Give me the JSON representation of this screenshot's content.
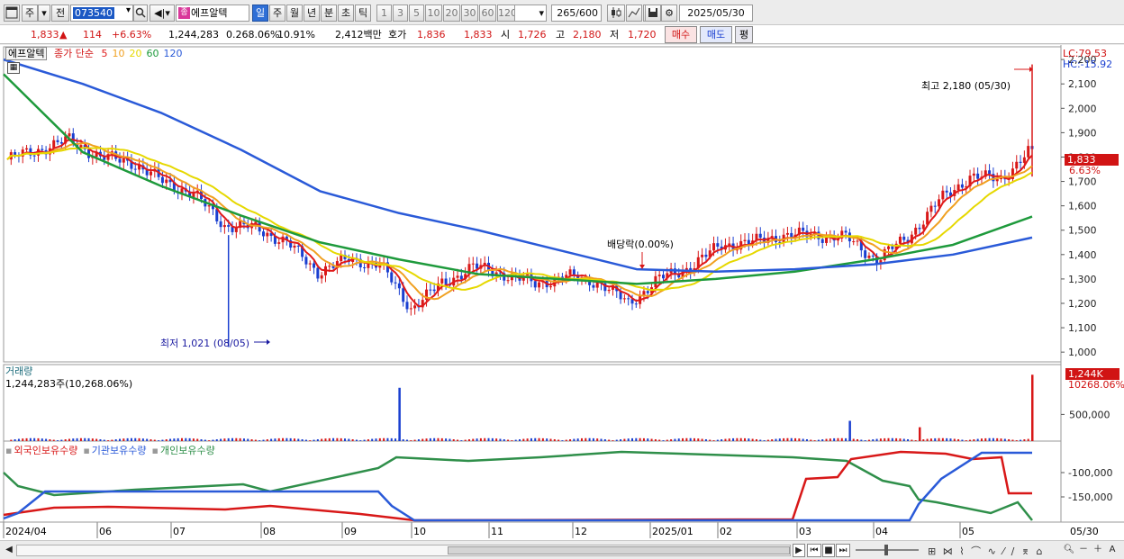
{
  "toolbar": {
    "market_label": "주",
    "prev_label": "전",
    "stock_code": "073540",
    "stock_name": "에프알텍",
    "name_badge": "종",
    "periods": [
      "일",
      "주",
      "월",
      "년",
      "분",
      "초",
      "틱"
    ],
    "selected_period": "일",
    "intervals": [
      "1",
      "3",
      "5",
      "10",
      "20",
      "30",
      "60",
      "120"
    ],
    "count_display": "265",
    "count_total": "/600",
    "date": "2025/05/30"
  },
  "quote": {
    "price": "1,833",
    "change": "114",
    "change_pct": "+6.63%",
    "volume": "1,244,283",
    "volume_pct": "0.268.06%",
    "turnover_pct": "10.91%",
    "amount": "2,412백만",
    "bid_label": "호가",
    "bid": "1,836",
    "ask": "1,833",
    "open_label": "시",
    "open": "1,726",
    "high_label": "고",
    "high": "2,180",
    "low_label": "저",
    "low": "1,720",
    "buy_button": "매수",
    "sell_button": "매도",
    "eval_button": "평"
  },
  "chart": {
    "legend_name": "에프알텍",
    "legend_ma_prefix": "종가 단순",
    "legend_ma": [
      {
        "label": "5",
        "color": "#e01a1a"
      },
      {
        "label": "10",
        "color": "#f0a020"
      },
      {
        "label": "20",
        "color": "#e6d800"
      },
      {
        "label": "60",
        "color": "#1e9a3c"
      },
      {
        "label": "120",
        "color": "#2a5ad8"
      }
    ],
    "lc_label": "LC:79.53",
    "hc_label": "HC:-15.92",
    "high_annotation": "최고 2,180 (05/30)",
    "low_annotation": "최저 1,021 (08/05)",
    "dividend_annotation": "배당락(0.00%)",
    "price_tag": "1,833",
    "price_pct_tag": "6.63%",
    "volume_title": "거래량",
    "volume_value": "1,244,283주(10,268.06%)",
    "volume_tag": "1,244K",
    "volume_pct_tag": "10268.06%",
    "holdings_legend": [
      "외국인보유수량",
      "기관보유수량",
      "개인보유수량"
    ],
    "x_labels": [
      "2024/04",
      "06",
      "07",
      "08",
      "09",
      "10",
      "11",
      "12",
      "2025/01",
      "02",
      "03",
      "04",
      "05"
    ],
    "x_right_label": "05/30"
  },
  "chart_data": [
    {
      "type": "candlestick",
      "title": "에프알텍",
      "y_ticks": [
        1000,
        1100,
        1200,
        1300,
        1400,
        1500,
        1600,
        1700,
        1800,
        1900,
        2000,
        2100,
        2200
      ],
      "y_tick_labels": [
        "1,000",
        "1,100",
        "1,200",
        "1,300",
        "1,400",
        "1,500",
        "1,600",
        "1,700",
        "1,800",
        "1,900",
        "2,000",
        "2,100",
        "2,200"
      ],
      "ylim": [
        960,
        2230
      ],
      "close_path": [
        [
          "2024/04",
          1790
        ],
        [
          "2024/04b",
          1830
        ],
        [
          "2024/05",
          1870
        ],
        [
          "2024/05b",
          1800
        ],
        [
          "2024/06",
          1780
        ],
        [
          "2024/06b",
          1700
        ],
        [
          "2024/07",
          1650
        ],
        [
          "2024/07b",
          1520
        ],
        [
          "2024/07c",
          1510
        ],
        [
          "2024/08",
          1450
        ],
        [
          "2024/08b",
          1330
        ],
        [
          "2024/08c",
          1380
        ],
        [
          "2024/09",
          1360
        ],
        [
          "2024/09b",
          1180
        ],
        [
          "2024/09c",
          1280
        ],
        [
          "2024/10",
          1350
        ],
        [
          "2024/10b",
          1320
        ],
        [
          "2024/11",
          1280
        ],
        [
          "2024/11b",
          1310
        ],
        [
          "2024/12",
          1290
        ],
        [
          "2024/12b",
          1200
        ],
        [
          "2024/12c",
          1300
        ],
        [
          "2025/01",
          1350
        ],
        [
          "2025/01b",
          1440
        ],
        [
          "2025/02",
          1450
        ],
        [
          "2025/02b",
          1480
        ],
        [
          "2025/03",
          1480
        ],
        [
          "2025/03b",
          1470
        ],
        [
          "2025/04",
          1380
        ],
        [
          "2025/04b",
          1470
        ],
        [
          "2025/04c",
          1620
        ],
        [
          "2025/05",
          1720
        ],
        [
          "2025/05b",
          1710
        ],
        [
          "2025/05/30",
          1833
        ]
      ],
      "series_ma": [
        {
          "name": "5",
          "color": "#e01a1a"
        },
        {
          "name": "10",
          "color": "#f0a020"
        },
        {
          "name": "20",
          "color": "#e6d800"
        },
        {
          "name": "60",
          "color": "#1e9a3c"
        },
        {
          "name": "120",
          "color": "#2a5ad8"
        }
      ],
      "ma60_path": [
        [
          0,
          2140
        ],
        [
          1,
          1820
        ],
        [
          2,
          1680
        ],
        [
          3,
          1560
        ],
        [
          4,
          1450
        ],
        [
          5,
          1380
        ],
        [
          6,
          1320
        ],
        [
          7,
          1300
        ],
        [
          8,
          1280
        ],
        [
          9,
          1300
        ],
        [
          10,
          1330
        ],
        [
          11,
          1380
        ],
        [
          12,
          1440
        ],
        [
          13,
          1556
        ]
      ],
      "ma120_path": [
        [
          0,
          2200
        ],
        [
          1,
          2100
        ],
        [
          2,
          1980
        ],
        [
          3,
          1830
        ],
        [
          4,
          1660
        ],
        [
          5,
          1570
        ],
        [
          6,
          1500
        ],
        [
          7,
          1420
        ],
        [
          8,
          1340
        ],
        [
          9,
          1330
        ],
        [
          10,
          1340
        ],
        [
          11,
          1360
        ],
        [
          12,
          1400
        ],
        [
          13,
          1470
        ]
      ],
      "high": {
        "value": 2180,
        "date": "05/30"
      },
      "low": {
        "value": 1021,
        "date": "08/05"
      }
    },
    {
      "type": "bar",
      "title": "거래량",
      "y_ticks": [
        500000
      ],
      "y_tick_labels": [
        "500,000"
      ],
      "last_volume": 1244283,
      "spikes": [
        {
          "x": "2024/10",
          "value": 1000000
        },
        {
          "x": "2025/03",
          "value": 380000
        },
        {
          "x": "2025/04",
          "value": 260000
        },
        {
          "x": "2025/05/30",
          "value": 1244283
        }
      ]
    },
    {
      "type": "line",
      "series": [
        {
          "name": "외국인보유수량",
          "color": "#d81818"
        },
        {
          "name": "기관보유수량",
          "color": "#2a5ad8"
        },
        {
          "name": "개인보유수량",
          "color": "#2f8f4a"
        }
      ],
      "y_ticks": [
        -100000,
        -150000
      ],
      "y_tick_labels": [
        "-100,000",
        "-150,000"
      ]
    }
  ],
  "bottom": {
    "nav_labels": [
      "▶",
      "⏮",
      "■",
      "⏭"
    ],
    "zoom_labels": [
      "－",
      "＋",
      "A"
    ]
  }
}
